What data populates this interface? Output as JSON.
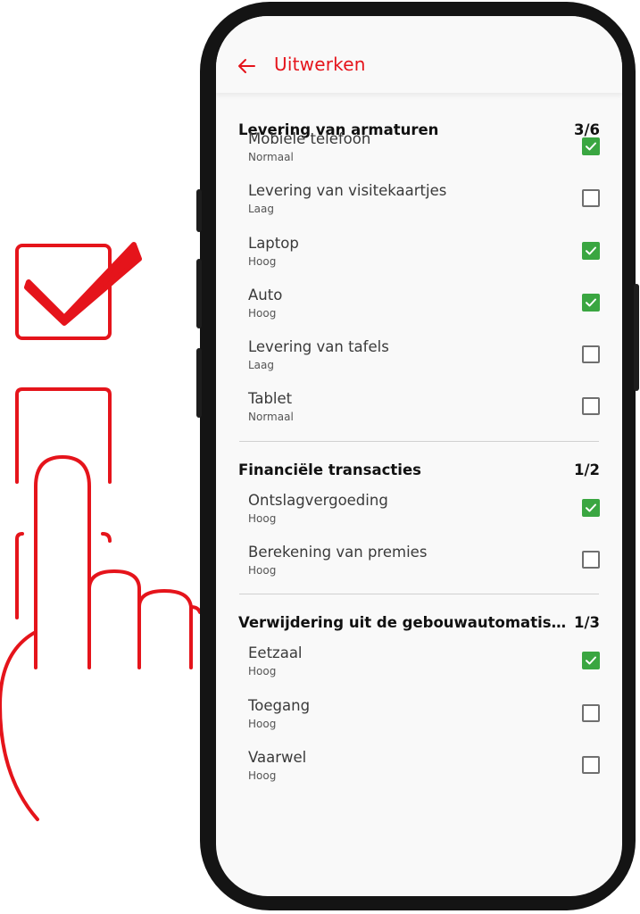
{
  "app_bar": {
    "back_icon": "arrow-left-icon",
    "title": "Uitwerken",
    "accent_color": "#e5141b"
  },
  "colors": {
    "checked": "#3aa641",
    "illustration": "#e5141b"
  },
  "sections": [
    {
      "title": "Levering van armaturen",
      "count": "3/6",
      "items": [
        {
          "label": "Mobiele telefoon",
          "priority": "Normaal",
          "checked": true
        },
        {
          "label": "Levering van visitekaartjes",
          "priority": "Laag",
          "checked": false
        },
        {
          "label": "Laptop",
          "priority": "Hoog",
          "checked": true
        },
        {
          "label": "Auto",
          "priority": "Hoog",
          "checked": true
        },
        {
          "label": "Levering van tafels",
          "priority": "Laag",
          "checked": false
        },
        {
          "label": "Tablet",
          "priority": "Normaal",
          "checked": false
        }
      ]
    },
    {
      "title": "Financiële transacties",
      "count": "1/2",
      "items": [
        {
          "label": "Ontslagvergoeding",
          "priority": "Hoog",
          "checked": true
        },
        {
          "label": "Berekening van premies",
          "priority": "Hoog",
          "checked": false
        }
      ]
    },
    {
      "title": "Verwijdering uit de gebouwautomatisering",
      "count": "1/3",
      "items": [
        {
          "label": "Eetzaal",
          "priority": "Hoog",
          "checked": true
        },
        {
          "label": "Toegang",
          "priority": "Hoog",
          "checked": false
        },
        {
          "label": "Vaarwel",
          "priority": "Hoog",
          "checked": false
        }
      ]
    }
  ]
}
